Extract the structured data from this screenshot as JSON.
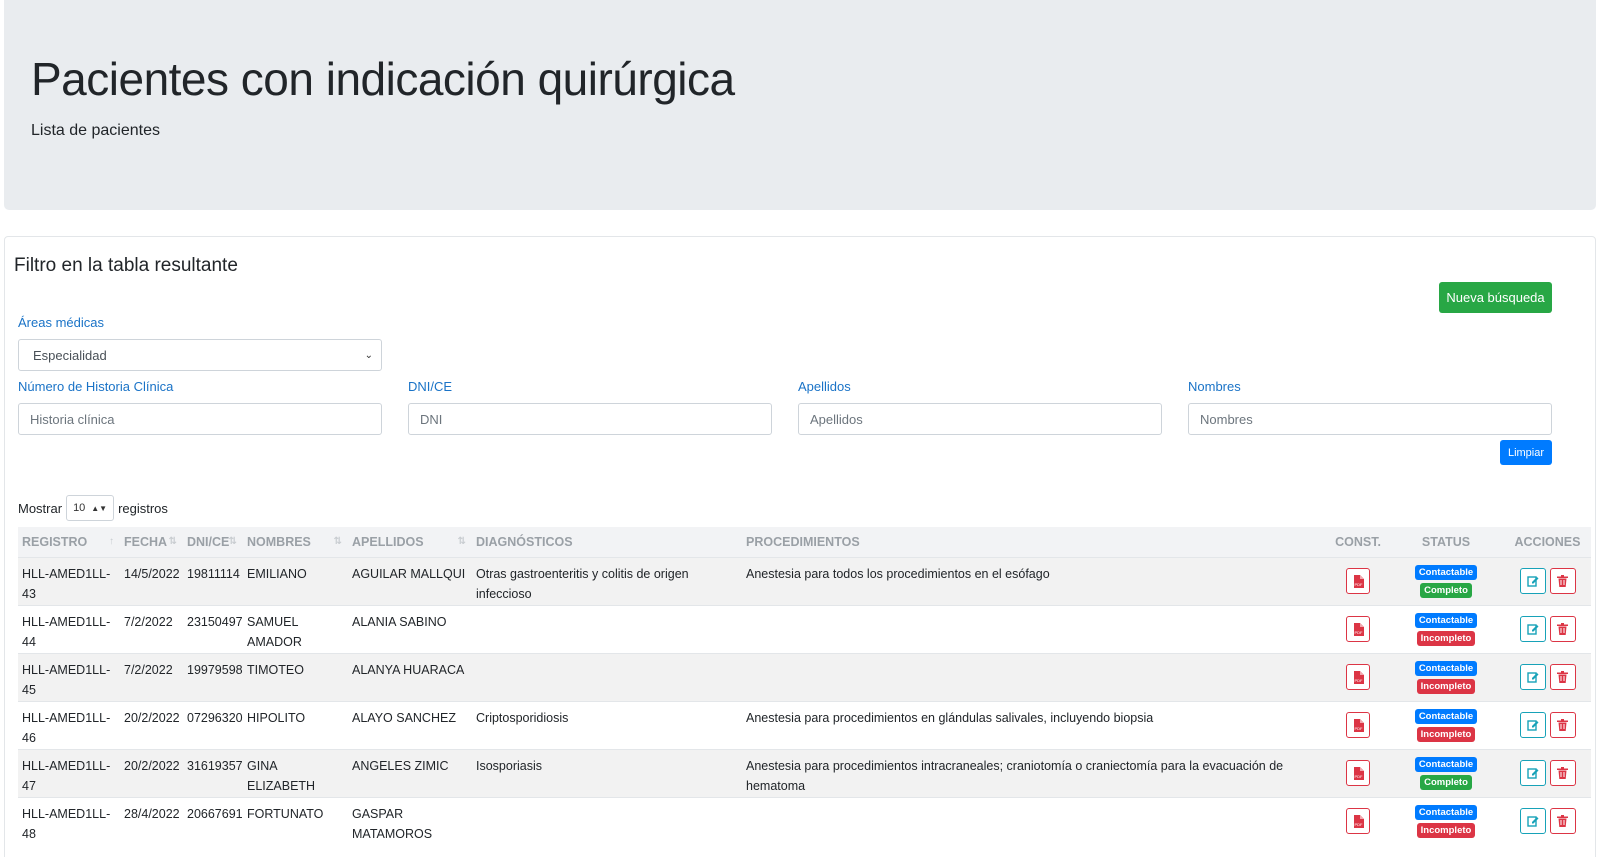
{
  "header": {
    "title": "Pacientes con indicación quirúrgica",
    "subtitle": "Lista de pacientes"
  },
  "filter": {
    "title": "Filtro en la tabla resultante",
    "new_search_label": "Nueva búsqueda",
    "areas_label": "Áreas médicas",
    "areas_selected": "Especialidad",
    "hc_label": "Número de Historia Clínica",
    "hc_placeholder": "Historia clínica",
    "dni_label": "DNI/CE",
    "dni_placeholder": "DNI",
    "apellidos_label": "Apellidos",
    "apellidos_placeholder": "Apellidos",
    "nombres_label": "Nombres",
    "nombres_placeholder": "Nombres",
    "clear_label": "Limpiar"
  },
  "length": {
    "prefix": "Mostrar",
    "value": "10",
    "suffix": "registros"
  },
  "table": {
    "columns": [
      "REGISTRO",
      "FECHA",
      "DNI/CE",
      "NOMBRES",
      "APELLIDOS",
      "DIAGNÓSTICOS",
      "PROCEDIMIENTOS",
      "CONST.",
      "STATUS",
      "ACCIONES"
    ],
    "rows": [
      {
        "registro": "HLL-AMED1LL-43",
        "fecha": "14/5/2022",
        "dni": "19811114",
        "nombres": "EMILIANO",
        "apellidos": "AGUILAR MALLQUI",
        "diagnostico": "Otras gastroenteritis y colitis de origen infeccioso",
        "procedimiento": "Anestesia para todos los procedimientos en el esófago",
        "status1": "Contactable",
        "status2": "Completo"
      },
      {
        "registro": "HLL-AMED1LL-44",
        "fecha": "7/2/2022",
        "dni": "23150497",
        "nombres": "SAMUEL AMADOR",
        "apellidos": "ALANIA SABINO",
        "diagnostico": "",
        "procedimiento": "",
        "status1": "Contactable",
        "status2": "Incompleto"
      },
      {
        "registro": "HLL-AMED1LL-45",
        "fecha": "7/2/2022",
        "dni": "19979598",
        "nombres": "TIMOTEO",
        "apellidos": "ALANYA HUARACA",
        "diagnostico": "",
        "procedimiento": "",
        "status1": "Contactable",
        "status2": "Incompleto"
      },
      {
        "registro": "HLL-AMED1LL-46",
        "fecha": "20/2/2022",
        "dni": "07296320",
        "nombres": "HIPOLITO",
        "apellidos": "ALAYO SANCHEZ",
        "diagnostico": "Criptosporidiosis",
        "procedimiento": "Anestesia para procedimientos en glándulas salivales, incluyendo biopsia",
        "status1": "Contactable",
        "status2": "Incompleto"
      },
      {
        "registro": "HLL-AMED1LL-47",
        "fecha": "20/2/2022",
        "dni": "31619357",
        "nombres": "GINA ELIZABETH",
        "apellidos": "ANGELES ZIMIC",
        "diagnostico": "Isosporiasis",
        "procedimiento": "Anestesia para procedimientos intracraneales; craniotomía o craniectomía para la evacuación de hematoma",
        "status1": "Contactable",
        "status2": "Completo"
      },
      {
        "registro": "HLL-AMED1LL-48",
        "fecha": "28/4/2022",
        "dni": "20667691",
        "nombres": "FORTUNATO",
        "apellidos": "GASPAR MATAMOROS",
        "diagnostico": "",
        "procedimiento": "",
        "status1": "Contactable",
        "status2": "Incompleto"
      }
    ]
  },
  "colors": {
    "primary": "#007bff",
    "success": "#28a745",
    "danger": "#dc3545",
    "info": "#17a2b8",
    "label": "#1a73c7"
  },
  "icons": {
    "pdf": "file-pdf-icon",
    "edit": "edit-icon",
    "delete": "trash-icon"
  }
}
